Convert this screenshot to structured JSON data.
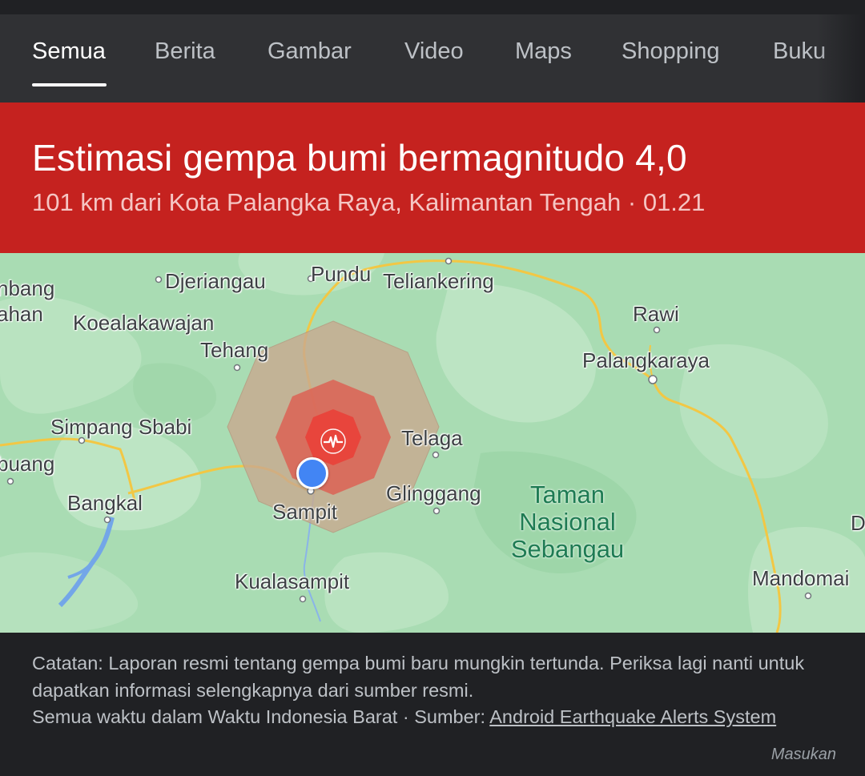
{
  "tabs": [
    {
      "label": "Semua",
      "active": true
    },
    {
      "label": "Berita"
    },
    {
      "label": "Gambar"
    },
    {
      "label": "Video"
    },
    {
      "label": "Maps"
    },
    {
      "label": "Shopping"
    },
    {
      "label": "Buku"
    }
  ],
  "banner": {
    "title": "Estimasi gempa bumi bermagnitudo 4,0",
    "subtitle": "101 km dari Kota Palangka Raya, Kalimantan Tengah · 01.21",
    "color": "#c5221f"
  },
  "map": {
    "places": [
      {
        "id": "nbang",
        "label": "nbang"
      },
      {
        "id": "ahan",
        "label": "ahan"
      },
      {
        "id": "djeriangau",
        "label": "Djeriangau"
      },
      {
        "id": "pundu",
        "label": "Pundu"
      },
      {
        "id": "teliankering",
        "label": "Teliankering"
      },
      {
        "id": "koealakawajan",
        "label": "Koealakawajan"
      },
      {
        "id": "rawi",
        "label": "Rawi"
      },
      {
        "id": "tehang",
        "label": "Tehang"
      },
      {
        "id": "palangkaraya",
        "label": "Palangkaraya"
      },
      {
        "id": "simpang-sbabi",
        "label": "Simpang Sbabi"
      },
      {
        "id": "telaga",
        "label": "Telaga"
      },
      {
        "id": "buang",
        "label": "buang"
      },
      {
        "id": "glinggang",
        "label": "Glinggang"
      },
      {
        "id": "bangkal",
        "label": "Bangkal"
      },
      {
        "id": "sampit",
        "label": "Sampit"
      },
      {
        "id": "kualasampit",
        "label": "Kualasampit"
      },
      {
        "id": "mandomai",
        "label": "Mandomai"
      },
      {
        "id": "d",
        "label": "D"
      }
    ],
    "park_label_lines": [
      "Taman",
      "Nasional",
      "Sebangau"
    ],
    "epicenter_icon": "earthquake-epicenter-icon",
    "location_icon": "current-location-dot-icon"
  },
  "footer": {
    "note_line1": "Catatan: Laporan resmi tentang gempa bumi baru mungkin tertunda. Periksa lagi nanti untuk dapatkan informasi selengkapnya dari sumber resmi.",
    "note_line2_prefix": "Semua waktu dalam Waktu Indonesia Barat · Sumber: ",
    "source_link": "Android Earthquake Alerts System",
    "feedback": "Masukan"
  }
}
